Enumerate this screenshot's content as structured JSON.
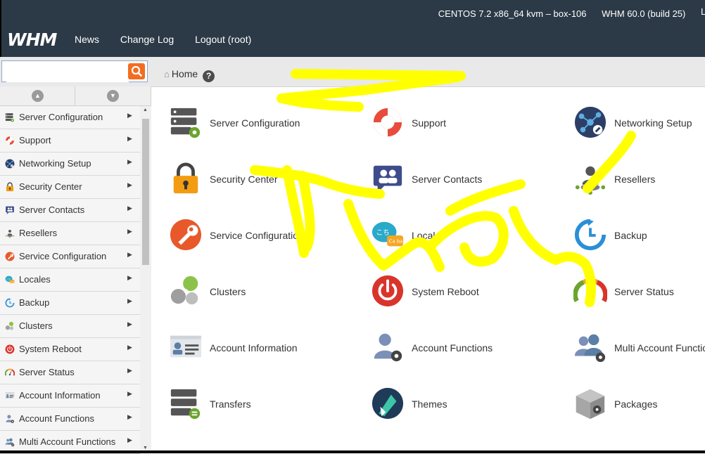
{
  "header": {
    "logo": "WHM",
    "system": "CENTOS 7.2 x86_64 kvm – box-106",
    "version": "WHM 60.0 (build 25)",
    "truncated": "L",
    "nav": [
      "News",
      "Change Log",
      "Logout (root)"
    ]
  },
  "search": {
    "value": "",
    "placeholder": ""
  },
  "breadcrumb": {
    "home": "Home",
    "help": "?"
  },
  "sidebar": {
    "items": [
      {
        "label": "Server Configuration",
        "icon": "server-config-icon"
      },
      {
        "label": "Support",
        "icon": "lifebuoy-icon"
      },
      {
        "label": "Networking Setup",
        "icon": "network-icon"
      },
      {
        "label": "Security Center",
        "icon": "lock-icon"
      },
      {
        "label": "Server Contacts",
        "icon": "contacts-icon"
      },
      {
        "label": "Resellers",
        "icon": "reseller-icon"
      },
      {
        "label": "Service Configuration",
        "icon": "wrench-icon"
      },
      {
        "label": "Locales",
        "icon": "locales-icon"
      },
      {
        "label": "Backup",
        "icon": "backup-icon"
      },
      {
        "label": "Clusters",
        "icon": "clusters-icon"
      },
      {
        "label": "System Reboot",
        "icon": "power-icon"
      },
      {
        "label": "Server Status",
        "icon": "gauge-icon"
      },
      {
        "label": "Account Information",
        "icon": "account-info-icon"
      },
      {
        "label": "Account Functions",
        "icon": "account-functions-icon"
      },
      {
        "label": "Multi Account Functions",
        "icon": "multi-account-icon"
      }
    ]
  },
  "main": {
    "tiles": [
      {
        "label": "Server Configuration",
        "icon": "server-config-icon"
      },
      {
        "label": "Support",
        "icon": "lifebuoy-icon"
      },
      {
        "label": "Networking Setup",
        "icon": "network-icon"
      },
      {
        "label": "Security Center",
        "icon": "lock-icon"
      },
      {
        "label": "Server Contacts",
        "icon": "contacts-icon"
      },
      {
        "label": "Resellers",
        "icon": "reseller-icon"
      },
      {
        "label": "Service Configuration",
        "icon": "wrench-icon"
      },
      {
        "label": "Locales",
        "icon": "locales-icon"
      },
      {
        "label": "Backup",
        "icon": "backup-icon"
      },
      {
        "label": "Clusters",
        "icon": "clusters-icon"
      },
      {
        "label": "System Reboot",
        "icon": "power-icon"
      },
      {
        "label": "Server Status",
        "icon": "gauge-icon"
      },
      {
        "label": "Account Information",
        "icon": "account-info-icon"
      },
      {
        "label": "Account Functions",
        "icon": "account-functions-icon"
      },
      {
        "label": "Multi Account Functions",
        "icon": "multi-account-icon"
      },
      {
        "label": "Transfers",
        "icon": "transfers-icon"
      },
      {
        "label": "Themes",
        "icon": "themes-icon"
      },
      {
        "label": "Packages",
        "icon": "packages-icon"
      }
    ]
  },
  "colors": {
    "header_bg": "#2c3a47",
    "search_button": "#f26d21",
    "annotation": "#ffff00"
  }
}
